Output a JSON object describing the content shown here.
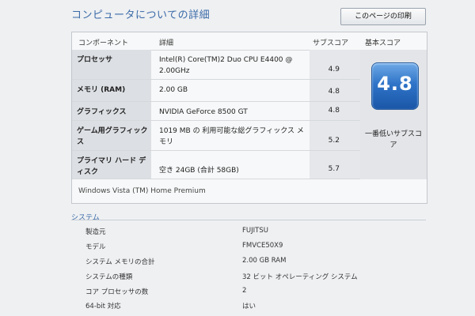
{
  "page": {
    "title": "コンピュータについての詳細",
    "print_button": "このページの印刷"
  },
  "score_table": {
    "headers": {
      "component": "コンポーネント",
      "detail": "詳細",
      "subscore": "サブスコア",
      "base": "基本スコア"
    },
    "rows": [
      {
        "category": "プロセッサ",
        "detail": "Intel(R) Core(TM)2 Duo CPU E4400 @ 2.00GHz",
        "score": "4.9"
      },
      {
        "category": "メモリ (RAM)",
        "detail": "2.00 GB",
        "score": "4.8"
      },
      {
        "category": "グラフィックス",
        "detail": "NVIDIA GeForce 8500 GT",
        "score": "4.8"
      },
      {
        "category": "ゲーム用グラフィックス",
        "detail": "1019 MB の 利用可能な総グラフィックス メモリ",
        "score": "5.2"
      },
      {
        "category": "プライマリ ハード ディスク",
        "detail": "空き 24GB (合計 58GB)",
        "score": "5.7"
      }
    ],
    "base_score": "4.8",
    "base_score_caption": "一番低いサブスコア",
    "os": "Windows Vista (TM) Home Premium"
  },
  "system": {
    "title": "システム",
    "rows": [
      {
        "label": "製造元",
        "value": "FUJITSU"
      },
      {
        "label": "モデル",
        "value": "FMVCE50X9"
      },
      {
        "label": "システム メモリの合計",
        "value": "2.00 GB RAM"
      },
      {
        "label": "システムの種類",
        "value": "32 ビット オペレーティング システム"
      },
      {
        "label": "コア プロセッサの数",
        "value": "2"
      },
      {
        "label": "64-bit 対応",
        "value": "はい"
      }
    ]
  }
}
